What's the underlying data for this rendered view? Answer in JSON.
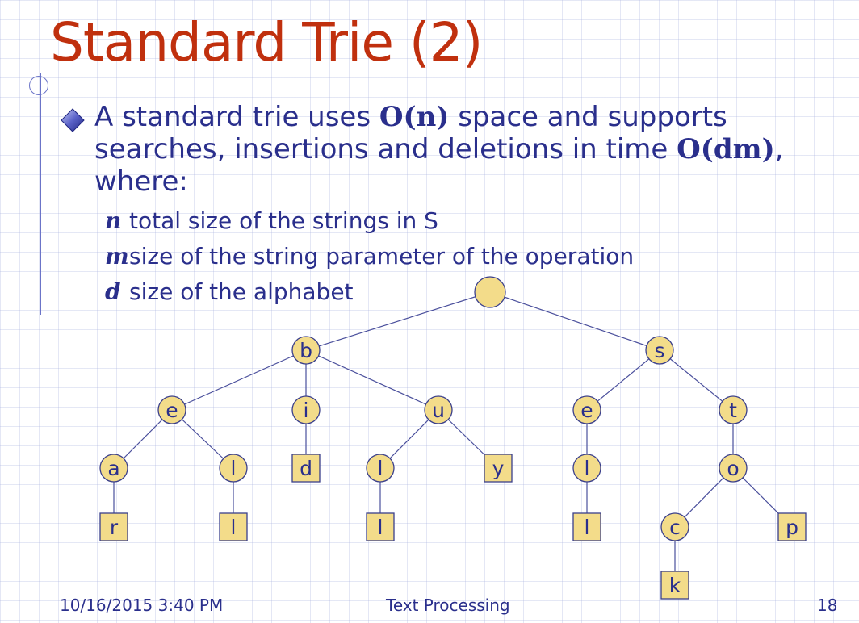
{
  "title": "Standard Trie (2)",
  "main": {
    "text_before_space": "A standard trie uses ",
    "space_bound": "O(n)",
    "text_middle": " space and supports searches, insertions and deletions in time ",
    "time_bound": "O(dm)",
    "text_after": ", where:"
  },
  "definitions": [
    {
      "var": "n",
      "text": "total size of the strings in S"
    },
    {
      "var": "m",
      "text": "size of the string parameter of the operation"
    },
    {
      "var": "d",
      "text": "size of the alphabet"
    }
  ],
  "trie": {
    "nodes": [
      {
        "id": "root",
        "label": "",
        "kind": "root"
      },
      {
        "id": "b",
        "label": "b",
        "kind": "internal"
      },
      {
        "id": "s",
        "label": "s",
        "kind": "internal"
      },
      {
        "id": "be",
        "label": "e",
        "kind": "internal"
      },
      {
        "id": "bi",
        "label": "i",
        "kind": "internal"
      },
      {
        "id": "bu",
        "label": "u",
        "kind": "internal"
      },
      {
        "id": "se",
        "label": "e",
        "kind": "internal"
      },
      {
        "id": "st",
        "label": "t",
        "kind": "internal"
      },
      {
        "id": "bea",
        "label": "a",
        "kind": "internal"
      },
      {
        "id": "bel",
        "label": "l",
        "kind": "internal"
      },
      {
        "id": "bid",
        "label": "d",
        "kind": "leaf"
      },
      {
        "id": "bul",
        "label": "l",
        "kind": "internal"
      },
      {
        "id": "buy",
        "label": "y",
        "kind": "leaf"
      },
      {
        "id": "sel",
        "label": "l",
        "kind": "internal"
      },
      {
        "id": "sto",
        "label": "o",
        "kind": "internal"
      },
      {
        "id": "bear",
        "label": "r",
        "kind": "leaf"
      },
      {
        "id": "bell",
        "label": "l",
        "kind": "leaf"
      },
      {
        "id": "bull",
        "label": "l",
        "kind": "leaf"
      },
      {
        "id": "sell",
        "label": "l",
        "kind": "leaf"
      },
      {
        "id": "stoc",
        "label": "c",
        "kind": "internal"
      },
      {
        "id": "stop",
        "label": "p",
        "kind": "leaf"
      },
      {
        "id": "stock",
        "label": "k",
        "kind": "leaf"
      }
    ],
    "edges": [
      [
        "root",
        "b"
      ],
      [
        "root",
        "s"
      ],
      [
        "b",
        "be"
      ],
      [
        "b",
        "bi"
      ],
      [
        "b",
        "bu"
      ],
      [
        "s",
        "se"
      ],
      [
        "s",
        "st"
      ],
      [
        "be",
        "bea"
      ],
      [
        "be",
        "bel"
      ],
      [
        "bi",
        "bid"
      ],
      [
        "bu",
        "bul"
      ],
      [
        "bu",
        "buy"
      ],
      [
        "se",
        "sel"
      ],
      [
        "st",
        "sto"
      ],
      [
        "bea",
        "bear"
      ],
      [
        "bel",
        "bell"
      ],
      [
        "bul",
        "bull"
      ],
      [
        "sel",
        "sell"
      ],
      [
        "sto",
        "stoc"
      ],
      [
        "sto",
        "stop"
      ],
      [
        "stoc",
        "stock"
      ]
    ]
  },
  "colors": {
    "title": "#c0300e",
    "text": "#2a2f8c",
    "node_fill": "#f3dc8a",
    "node_stroke": "#3a3f8c",
    "edge": "#4a4f9c"
  },
  "footer": {
    "date": "10/16/2015 3:40 PM",
    "center": "Text Processing",
    "page": "18"
  }
}
